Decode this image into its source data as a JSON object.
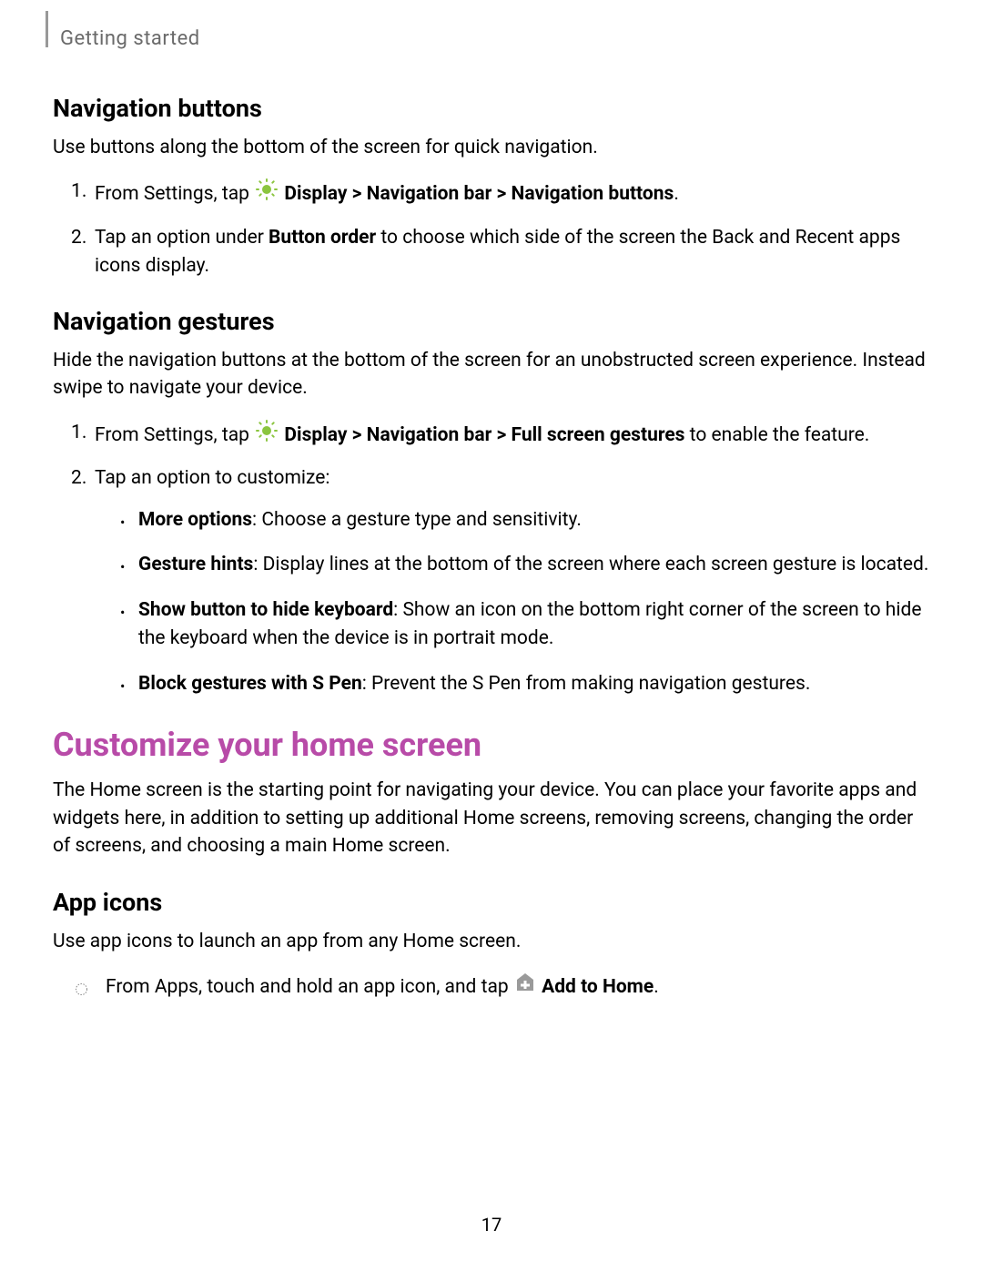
{
  "breadcrumb": "Getting started",
  "sections": {
    "navButtons": {
      "heading": "Navigation buttons",
      "intro": "Use buttons along the bottom of the screen for quick navigation.",
      "step1_pre": "From Settings, tap ",
      "step1_bold": " Display > Navigation bar > Navigation buttons",
      "step1_post": ".",
      "step2_pre": "Tap an option under ",
      "step2_bold": "Button order",
      "step2_post": " to choose which side of the screen the Back and Recent apps icons display."
    },
    "navGestures": {
      "heading": "Navigation gestures",
      "intro": "Hide the navigation buttons at the bottom of the screen for an unobstructed screen experience. Instead swipe to navigate your device.",
      "step1_pre": "From Settings, tap ",
      "step1_bold": " Display > Navigation bar > Full screen gestures",
      "step1_post": " to enable the feature.",
      "step2": "Tap an option to customize:",
      "bullets": {
        "b1_bold": "More options",
        "b1_rest": ": Choose a gesture type and sensitivity.",
        "b2_bold": "Gesture hints",
        "b2_rest": ": Display lines at the bottom of the screen where each screen gesture is located.",
        "b3_bold": "Show button to hide keyboard",
        "b3_rest": ": Show an icon on the bottom right corner of the screen to hide the keyboard when the device is in portrait mode.",
        "b4_bold": "Block gestures with S Pen",
        "b4_rest": ": Prevent the S Pen from making navigation gestures."
      }
    },
    "customize": {
      "heading": "Customize your home screen",
      "intro": "The Home screen is the starting point for navigating your device. You can place your favorite apps and widgets here, in addition to setting up additional Home screens, removing screens, changing the order of screens, and choosing a main Home screen."
    },
    "appIcons": {
      "heading": "App icons",
      "intro": "Use app icons to launch an app from any Home screen.",
      "step_pre": "From Apps, touch and hold an app icon, and tap ",
      "step_bold": " Add to Home",
      "step_post": "."
    }
  },
  "pageNumber": "17"
}
